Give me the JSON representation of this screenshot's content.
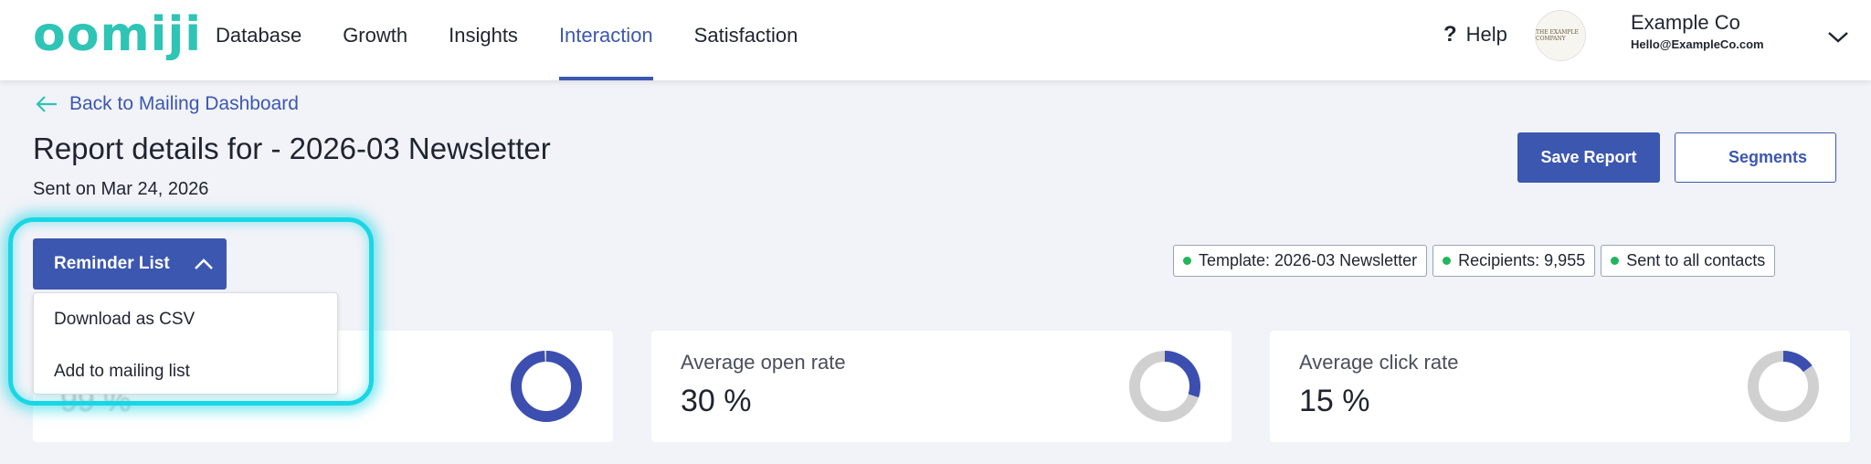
{
  "brand": {
    "logo_text": "oomiji",
    "accent": "#2ec4b6",
    "primary": "#3c57b0"
  },
  "nav": {
    "items": [
      {
        "label": "Database"
      },
      {
        "label": "Growth"
      },
      {
        "label": "Insights"
      },
      {
        "label": "Interaction",
        "active": true
      },
      {
        "label": "Satisfaction"
      }
    ],
    "help_label": "Help",
    "account_name": "Example Co",
    "account_email": "Hello@ExampleCo.com",
    "avatar_text": "THE EXAMPLE COMPANY"
  },
  "header": {
    "back_label": "Back to Mailing Dashboard",
    "title": "Report details for - 2026-03 Newsletter",
    "sent_on": "Sent on Mar 24, 2026",
    "save_label": "Save Report",
    "segments_label": "Segments"
  },
  "reminder": {
    "label": "Reminder List",
    "menu": [
      "Download as CSV",
      "Add to mailing list"
    ]
  },
  "tags": [
    "Template: 2026-03 Newsletter",
    "Recipients: 9,955",
    "Sent to all contacts"
  ],
  "stats": [
    {
      "label": "",
      "value": "99 %",
      "fraction": 0.99
    },
    {
      "label": "Average open rate",
      "value": "30 %",
      "fraction": 0.3
    },
    {
      "label": "Average click rate",
      "value": "15 %",
      "fraction": 0.15
    }
  ]
}
